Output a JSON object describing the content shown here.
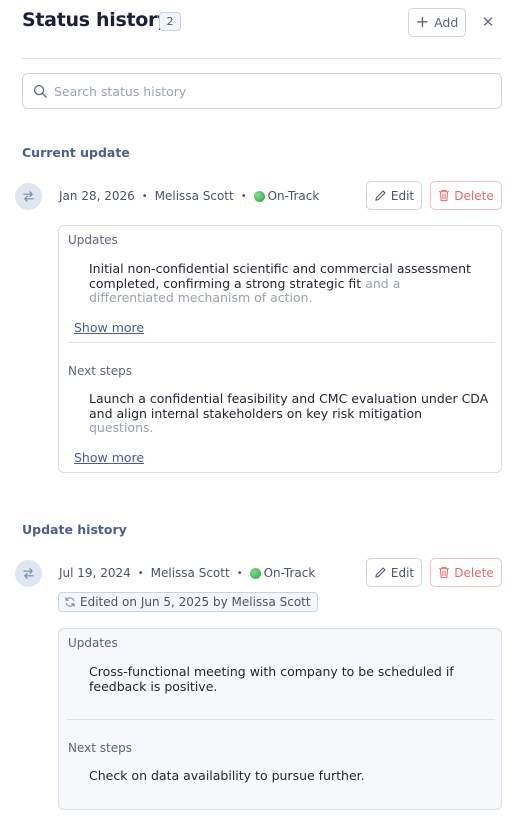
{
  "header": {
    "title": "Status history",
    "count": "2",
    "add_label": "Add",
    "close_glyph": "✕"
  },
  "search": {
    "placeholder": "Search status history",
    "value": ""
  },
  "current_section": {
    "title": "Current update",
    "entry": {
      "date": "Jan 28, 2026",
      "author": "Melissa Scott",
      "status": "On-Track",
      "edit_label": "Edit",
      "delete_label": "Delete",
      "updates_label": "Updates",
      "updates_text": "Initial non-confidential scientific and commercial assessment completed, confirming a strong strategic fit",
      "updates_text_faded": "and a differentiated mechanism of action.",
      "updates_show_more": "Show more",
      "next_steps_label": "Next steps",
      "next_steps_text": "Launch a confidential feasibility and CMC evaluation under CDA and align internal stakeholders on key risk mitigation",
      "next_steps_text_faded": "questions.",
      "next_steps_show_more": "Show more"
    }
  },
  "history_section": {
    "title": "Update history",
    "entry": {
      "date": "Jul 19, 2024",
      "author": "Melissa Scott",
      "status": "On-Track",
      "edited_note": "Edited on Jun 5, 2025 by Melissa Scott",
      "edit_label": "Edit",
      "delete_label": "Delete",
      "updates_label": "Updates",
      "updates_text": "Cross-functional meeting with company to be scheduled if feedback is positive.",
      "next_steps_label": "Next steps",
      "next_steps_text": "Check on data availability to pursue further."
    }
  },
  "colors": {
    "accent": "#4d5f8c",
    "status_on_track": "#3fb356",
    "delete": "#e26a6a"
  },
  "icons": {
    "search": "search-icon",
    "plus": "plus-icon",
    "close": "close-icon",
    "swap": "swap-arrows-icon",
    "edit": "pencil-icon",
    "delete": "trash-icon",
    "edited": "refresh-icon"
  }
}
